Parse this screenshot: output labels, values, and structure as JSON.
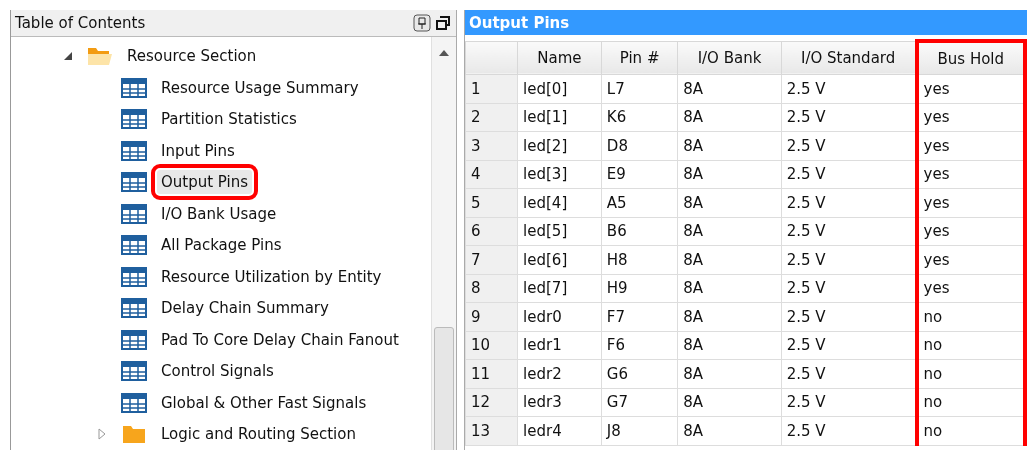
{
  "toc": {
    "title": "Table of Contents",
    "tree": [
      {
        "label": "Resource Section",
        "kind": "folder",
        "expanded": true,
        "selected": false,
        "children": [
          {
            "label": "Resource Usage Summary",
            "kind": "table",
            "selected": false
          },
          {
            "label": "Partition Statistics",
            "kind": "table",
            "selected": false
          },
          {
            "label": "Input Pins",
            "kind": "table",
            "selected": false
          },
          {
            "label": "Output Pins",
            "kind": "table",
            "selected": true
          },
          {
            "label": "I/O Bank Usage",
            "kind": "table",
            "selected": false
          },
          {
            "label": "All Package Pins",
            "kind": "table",
            "selected": false
          },
          {
            "label": "Resource Utilization by Entity",
            "kind": "table",
            "selected": false
          },
          {
            "label": "Delay Chain Summary",
            "kind": "table",
            "selected": false
          },
          {
            "label": "Pad To Core Delay Chain Fanout",
            "kind": "table",
            "selected": false
          },
          {
            "label": "Control Signals",
            "kind": "table",
            "selected": false
          },
          {
            "label": "Global & Other Fast Signals",
            "kind": "table",
            "selected": false
          }
        ]
      },
      {
        "label": "Logic and Routing Section",
        "kind": "folder",
        "expanded": false,
        "selected": false
      }
    ]
  },
  "report": {
    "title": "Output Pins",
    "table": {
      "columns": [
        {
          "highlighted": false
        },
        {
          "label": "Name",
          "highlighted": false
        },
        {
          "label": "Pin #",
          "highlighted": false
        },
        {
          "label": "I/O Bank",
          "highlighted": false
        },
        {
          "label": "I/O Standard",
          "highlighted": false
        },
        {
          "label": "Bus Hold",
          "highlighted": true
        }
      ],
      "rows": [
        [
          "1",
          "led[0]",
          "L7",
          "8A",
          "2.5 V",
          "yes"
        ],
        [
          "2",
          "led[1]",
          "K6",
          "8A",
          "2.5 V",
          "yes"
        ],
        [
          "3",
          "led[2]",
          "D8",
          "8A",
          "2.5 V",
          "yes"
        ],
        [
          "4",
          "led[3]",
          "E9",
          "8A",
          "2.5 V",
          "yes"
        ],
        [
          "5",
          "led[4]",
          "A5",
          "8A",
          "2.5 V",
          "yes"
        ],
        [
          "6",
          "led[5]",
          "B6",
          "8A",
          "2.5 V",
          "yes"
        ],
        [
          "7",
          "led[6]",
          "H8",
          "8A",
          "2.5 V",
          "yes"
        ],
        [
          "8",
          "led[7]",
          "H9",
          "8A",
          "2.5 V",
          "yes"
        ],
        [
          "9",
          "ledr0",
          "F7",
          "8A",
          "2.5 V",
          "no"
        ],
        [
          "10",
          "ledr1",
          "F6",
          "8A",
          "2.5 V",
          "no"
        ],
        [
          "11",
          "ledr2",
          "G6",
          "8A",
          "2.5 V",
          "no"
        ],
        [
          "12",
          "ledr3",
          "G7",
          "8A",
          "2.5 V",
          "no"
        ],
        [
          "13",
          "ledr4",
          "J8",
          "8A",
          "2.5 V",
          "no"
        ]
      ]
    }
  }
}
